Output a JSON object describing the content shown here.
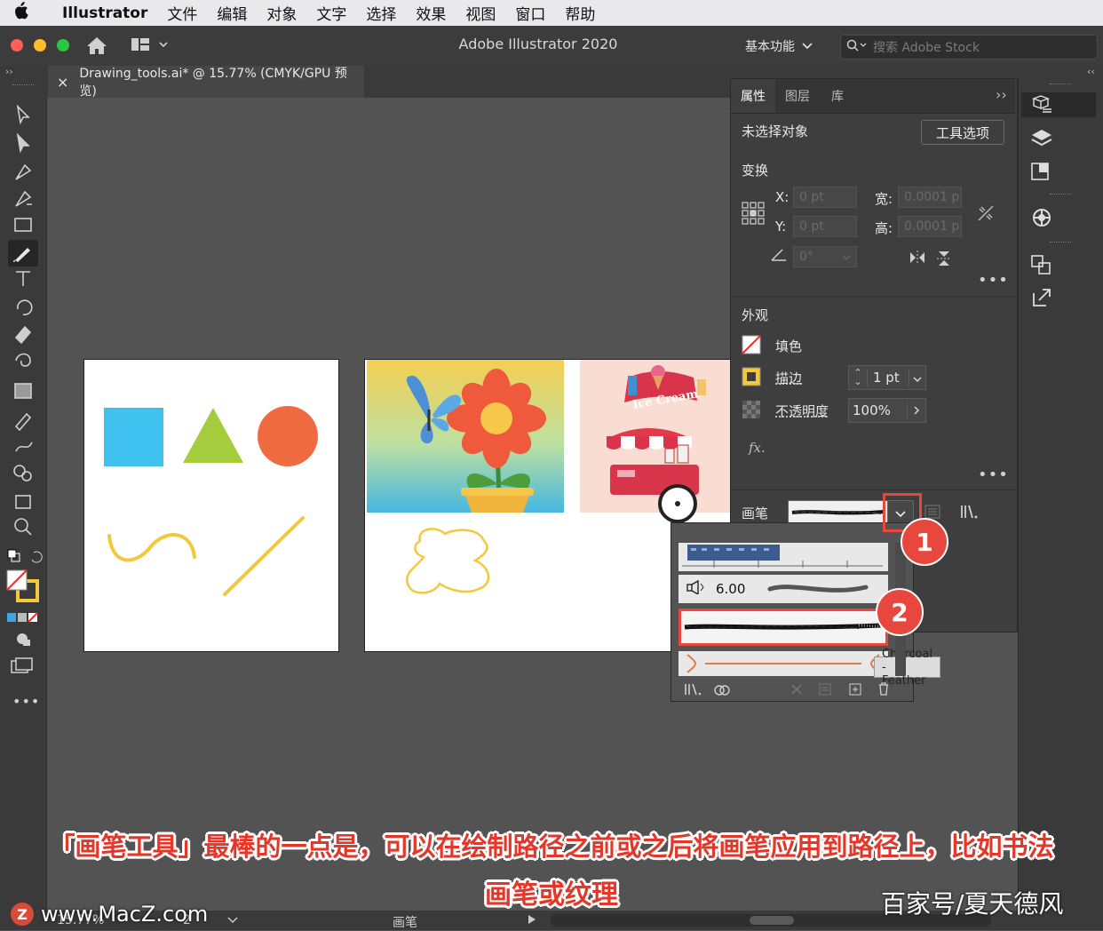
{
  "menubar": {
    "app_name": "Illustrator",
    "items": [
      "文件",
      "编辑",
      "对象",
      "文字",
      "选择",
      "效果",
      "视图",
      "窗口",
      "帮助"
    ]
  },
  "window": {
    "title": "Adobe Illustrator 2020",
    "workspace": "基本功能",
    "search_placeholder": "搜索 Adobe Stock"
  },
  "document_tab": {
    "close_glyph": "×",
    "title": "Drawing_tools.ai* @ 15.77% (CMYK/GPU 预览)"
  },
  "properties": {
    "tabs": [
      "属性",
      "图层",
      "库"
    ],
    "no_selection": "未选择对象",
    "tool_options_button": "工具选项",
    "transform": {
      "heading": "变换",
      "x_label": "X:",
      "x_value": "0 pt",
      "y_label": "Y:",
      "y_value": "0 pt",
      "w_label": "宽:",
      "w_value": "0.0001 p",
      "h_label": "高:",
      "h_value": "0.0001 p",
      "angle_value": "0°"
    },
    "appearance": {
      "heading": "外观",
      "fill_label": "填色",
      "stroke_label": "描边",
      "stroke_value": "1 pt",
      "opacity_label": "不透明度",
      "opacity_value": "100%",
      "fx_label": "fx."
    },
    "brush": {
      "label": "画笔"
    }
  },
  "brush_menu": {
    "size_value": "6.00",
    "tooltip": "Charcoal - Feather"
  },
  "artwork": {
    "ice_cream_text": "Ice Cream"
  },
  "callouts": [
    "1",
    "2"
  ],
  "caption": {
    "line1": "「画笔工具」最棒的一点是，可以在绘制路径之前或之后将画笔应用到路径上，比如书法",
    "line2": "画笔或纹理"
  },
  "watermarks": {
    "left": "www.MacZ.com",
    "right": "百家号/夏天德风"
  },
  "statusbar": {
    "zoom": "15.77%",
    "artboard_num": "2",
    "tool_name": "画笔"
  },
  "colors": {
    "callout_red": "#e8473d",
    "caption_red": "#e3372a",
    "highlight_box": "#e8473d",
    "blue_square": "#3fc1f0",
    "green_triangle": "#a5cc3d",
    "orange_circle": "#ef6a3f",
    "yellow_stroke": "#f3c83b"
  }
}
